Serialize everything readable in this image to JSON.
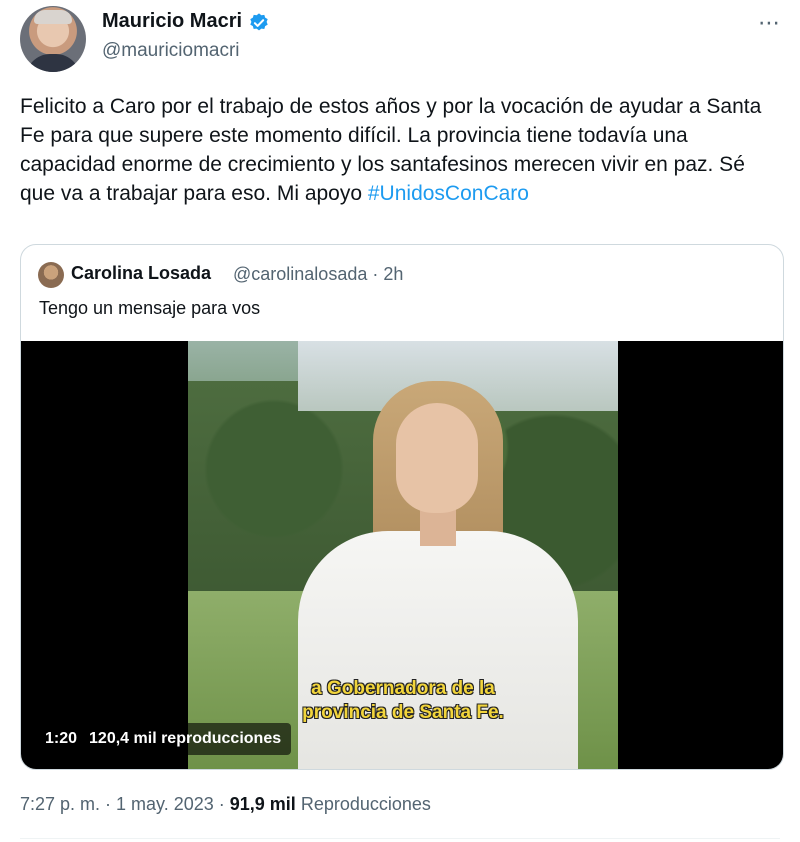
{
  "author": {
    "name": "Mauricio Macri",
    "handle": "@mauriciomacri",
    "verified": true
  },
  "more_icon": "⋯",
  "tweet": {
    "text": "Felicito a Caro por el trabajo de estos años y por la vocación de ayudar a Santa Fe para que supere este momento difícil. La provincia tiene todavía una capacidad enorme de crecimiento y los santafesinos merecen vivir en paz. Sé que va a trabajar para eso. Mi apoyo ",
    "hashtag": "#UnidosConCaro"
  },
  "quote": {
    "name": "Carolina Losada",
    "handle_time": "@carolinalosada · 2h",
    "text": "Tengo un mensaje para vos",
    "video": {
      "caption_line1": "a Gobernadora de la",
      "caption_line2": "provincia de Santa Fe.",
      "duration": "1:20",
      "views": "120,4 mil reproducciones"
    }
  },
  "meta": {
    "timestamp": "7:27 p. m. · 1 may. 2023 · ",
    "views_count": "91,9 mil",
    "views_label": " Reproducciones"
  },
  "colors": {
    "link": "#1d9bf0",
    "verified": "#1d9bf0",
    "secondary_text": "#536471"
  }
}
